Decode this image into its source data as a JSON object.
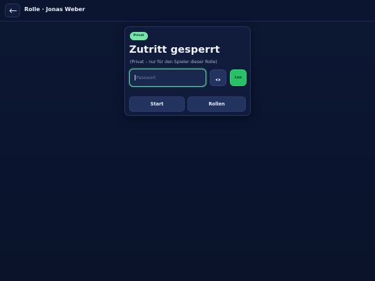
{
  "header": {
    "back_icon": "arrow-left-icon",
    "title": "Rolle · Jonas Weber"
  },
  "card": {
    "badge": "Privat",
    "title": "Zutritt gesperrt",
    "subtitle": "(Privat – nur für den Spieler dieser Rolle)",
    "password": {
      "value": "",
      "placeholder": "Passwort"
    },
    "reveal_icon": "eye-icon",
    "submit_label": "Los",
    "start_label": "Start",
    "roles_label": "Rollen"
  },
  "colors": {
    "background": "#0b1530",
    "card": "#111c3c",
    "accent_green": "#27c266",
    "badge_green": "#74e6a8",
    "focus_ring": "#5fd1a6",
    "button": "#22335f"
  }
}
